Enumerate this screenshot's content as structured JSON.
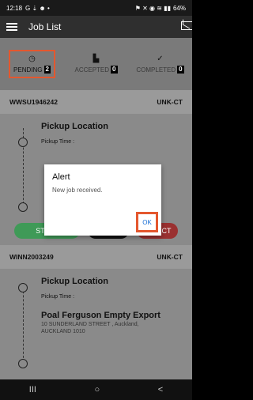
{
  "status_bar": {
    "time": "12:18",
    "left_icons": "G ⇣ ☻ •",
    "battery": "64%",
    "right_icons": "⚑ ✕ ◉ ≋ ▮▮"
  },
  "app_bar": {
    "title": "Job List"
  },
  "tabs": [
    {
      "label": "PENDING",
      "count": "2",
      "icon": "clock-icon"
    },
    {
      "label": "ACCEPTED",
      "count": "0",
      "icon": "document-icon"
    },
    {
      "label": "COMPLETED",
      "count": "0",
      "icon": "check-icon"
    }
  ],
  "jobs": [
    {
      "id": "WWSU1946242",
      "type": "UNK-CT",
      "pickup_title": "Pickup Location",
      "pickup_time_label": "Pickup Time :",
      "dest_title": "",
      "dest_address_1": "",
      "dest_address_2": "",
      "buttons": {
        "start": "START",
        "info": "INFO",
        "reject": "REJECT"
      }
    },
    {
      "id": "WINN2003249",
      "type": "UNK-CT",
      "pickup_title": "Pickup Location",
      "pickup_time_label": "Pickup Time :",
      "dest_title": "Poal Ferguson Empty Export",
      "dest_address_1": "10 SUNDERLAND STREET , Auckland,",
      "dest_address_2": "AUCKLAND 1010"
    }
  ],
  "dialog": {
    "title": "Alert",
    "message": "New job received.",
    "ok_label": "OK"
  },
  "nav": {
    "recents": "III",
    "home": "○",
    "back": "<"
  },
  "colors": {
    "highlight": "#e4572e",
    "start": "#3f9a57",
    "reject": "#9a3030",
    "ok_text": "#1a6fd6"
  }
}
